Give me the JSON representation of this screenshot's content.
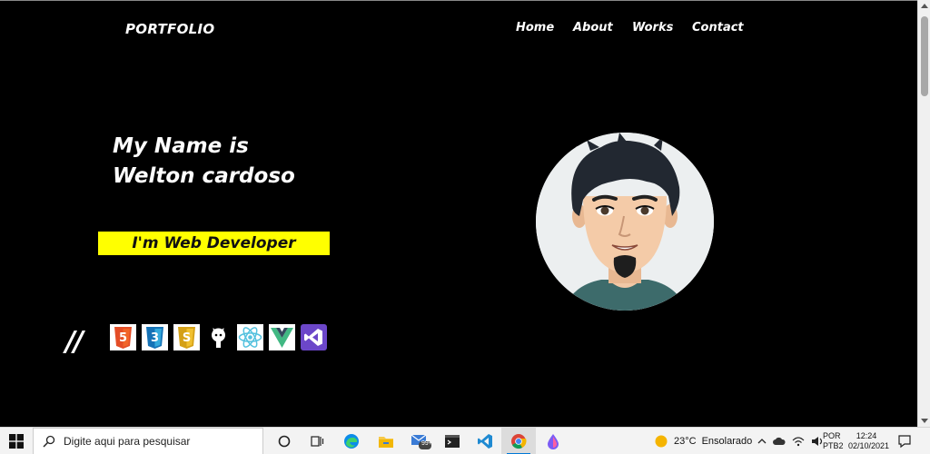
{
  "header": {
    "logo": "PORTFOLIO",
    "nav": [
      {
        "label": "Home"
      },
      {
        "label": "About"
      },
      {
        "label": "Works"
      },
      {
        "label": "Contact"
      }
    ]
  },
  "hero": {
    "title_line1": "My Name is",
    "title_line2": "Welton cardoso",
    "role": "I'm Web Developer",
    "slashes": "//",
    "tech_icons": [
      "html5-icon",
      "css3-icon",
      "javascript-icon",
      "github-icon",
      "react-icon",
      "vue-icon",
      "visual-studio-icon"
    ],
    "avatar": "developer-avatar-illustration"
  },
  "colors": {
    "background": "#000000",
    "accent": "#ffff00",
    "text": "#ffffff"
  },
  "taskbar": {
    "search_placeholder": "Digite aqui para pesquisar",
    "badge_count": "99+",
    "weather_temp": "23°C",
    "weather_text": "Ensolarado",
    "lang_line1": "POR",
    "lang_line2": "PTB2",
    "time": "12:24",
    "date": "02/10/2021"
  }
}
